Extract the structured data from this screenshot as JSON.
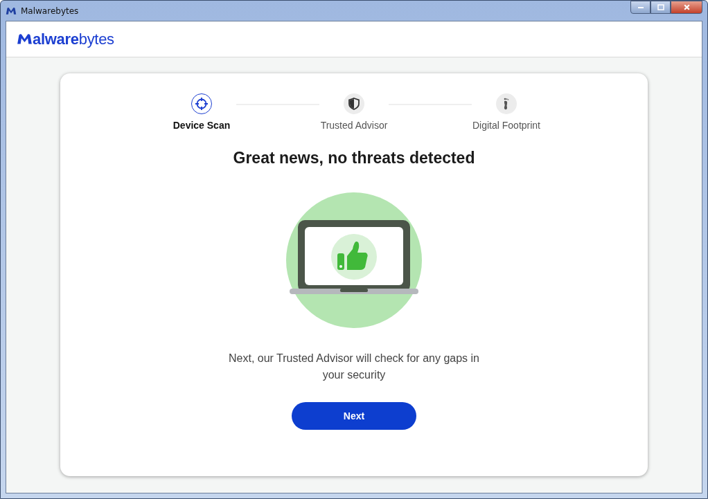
{
  "window": {
    "title": "Malwarebytes"
  },
  "header": {
    "logo_text": "**alware**bytes"
  },
  "steps": [
    {
      "label": "Device Scan",
      "selected": true,
      "kind": "crosshair"
    },
    {
      "label": "Trusted Advisor",
      "selected": false,
      "kind": "shield"
    },
    {
      "label": "Digital Footprint",
      "selected": false,
      "kind": "footprint"
    }
  ],
  "heading": "Great news, no threats detected",
  "message": "Next, our Trusted Advisor will check for any gaps in your security",
  "next_button": "Next"
}
